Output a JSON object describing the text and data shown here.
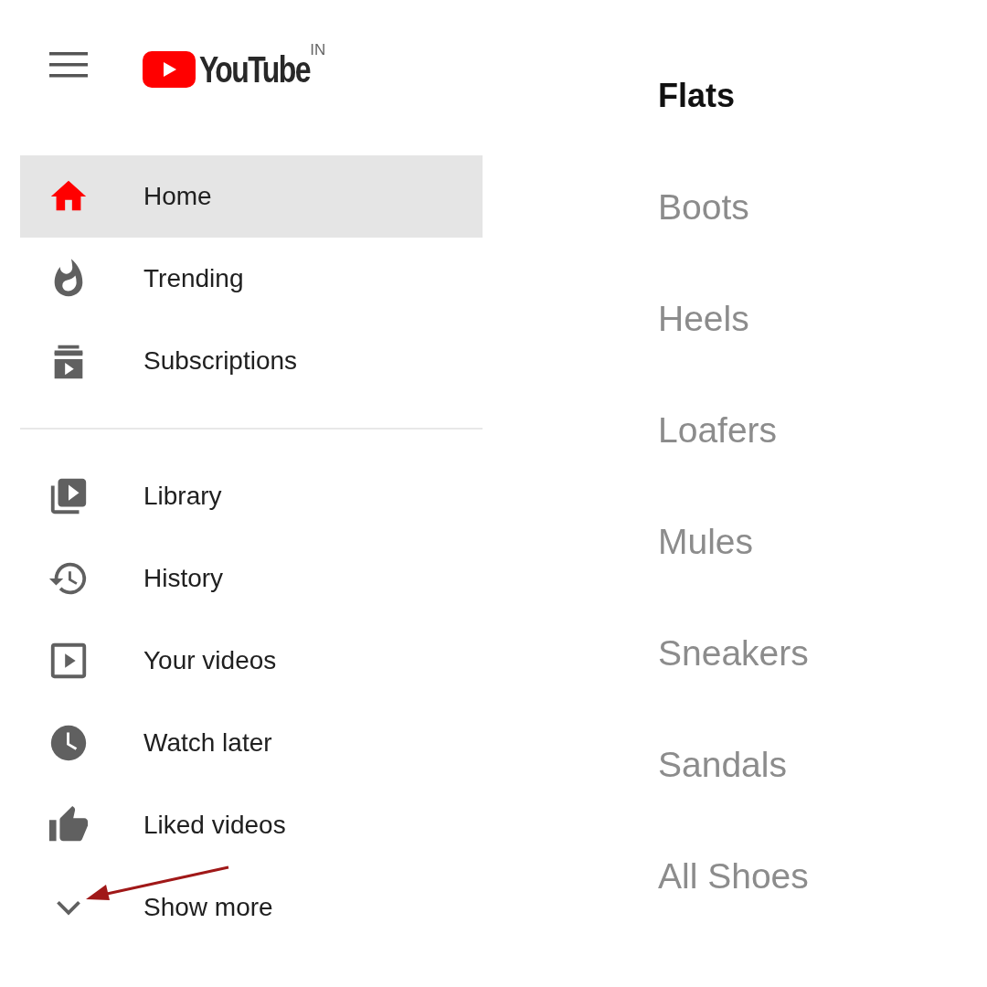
{
  "header": {
    "logo_text": "YouTube",
    "region": "IN"
  },
  "nav_sections": [
    {
      "items": [
        {
          "label": "Home",
          "selected": true
        },
        {
          "label": "Trending",
          "selected": false
        },
        {
          "label": "Subscriptions",
          "selected": false
        }
      ]
    },
    {
      "items": [
        {
          "label": "Library",
          "selected": false
        },
        {
          "label": "History",
          "selected": false
        },
        {
          "label": "Your videos",
          "selected": false
        },
        {
          "label": "Watch later",
          "selected": false
        },
        {
          "label": "Liked videos",
          "selected": false
        },
        {
          "label": "Show more",
          "selected": false
        }
      ]
    }
  ],
  "categories": [
    {
      "label": "Flats",
      "selected": true
    },
    {
      "label": "Boots",
      "selected": false
    },
    {
      "label": "Heels",
      "selected": false
    },
    {
      "label": "Loafers",
      "selected": false
    },
    {
      "label": "Mules",
      "selected": false
    },
    {
      "label": "Sneakers",
      "selected": false
    },
    {
      "label": "Sandals",
      "selected": false
    },
    {
      "label": "All Shoes",
      "selected": false
    }
  ]
}
